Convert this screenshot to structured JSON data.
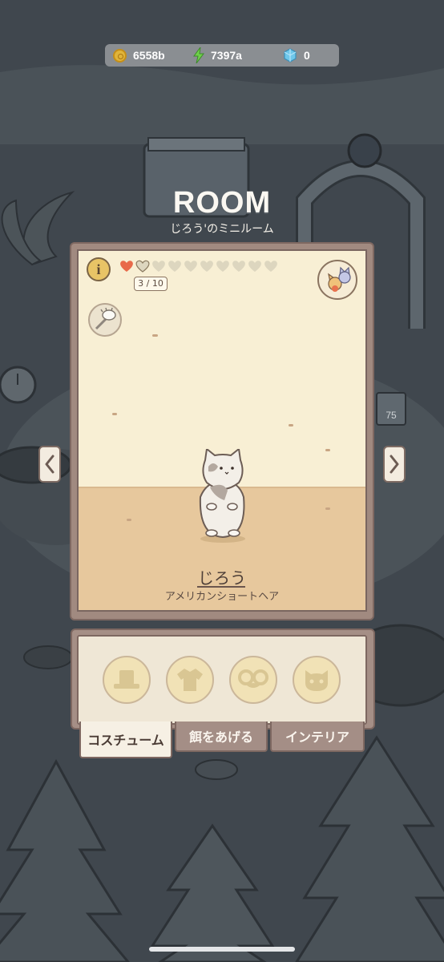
{
  "currency": {
    "coins": "6558b",
    "energy": "7397a",
    "gems": "0",
    "icons": [
      "coin-icon",
      "energy-bolt-icon",
      "gem-icon"
    ]
  },
  "header": {
    "title": "ROOM",
    "subtitle": "じろう'のミニルーム"
  },
  "room": {
    "affection_hearts_filled": 1,
    "affection_hearts_total": 10,
    "affection_count": "3 / 10",
    "level_sign": "75"
  },
  "cat": {
    "name": "じろう",
    "breed": "アメリカンショートヘア"
  },
  "tabs": [
    {
      "label": "コスチューム",
      "active": true
    },
    {
      "label": "餌をあげる",
      "active": false
    },
    {
      "label": "インテリア",
      "active": false
    }
  ],
  "costume_categories": [
    "hat-icon",
    "shirt-icon",
    "glasses-icon",
    "face-icon"
  ],
  "colors": {
    "frame": "#a18a80",
    "wall": "#f8efd4",
    "floor": "#e7c89d",
    "heart_filled": "#e86a4a",
    "heart_empty": "#ddd6bf"
  }
}
